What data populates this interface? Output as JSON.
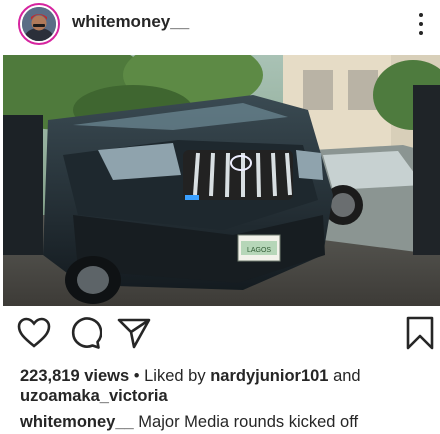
{
  "header": {
    "username": "whitemoney__",
    "avatar_icon": "profile-avatar",
    "more_icon": "more-options-icon"
  },
  "post": {
    "image_icon": "suv-photo",
    "plate_text": "LAGOS"
  },
  "actions": {
    "like_icon": "heart-icon",
    "comment_icon": "comment-icon",
    "share_icon": "send-icon",
    "save_icon": "bookmark-icon"
  },
  "stats": {
    "views": "223,819 views",
    "separator": " • Liked by ",
    "liked_by_user": "nardyjunior101",
    "and": " and",
    "other_user": "uzoamaka_victoria"
  },
  "caption": {
    "author": "whitemoney__",
    "text": " Major Media rounds kicked off"
  },
  "colors": {
    "text": "#262626",
    "story_ring": "#d6249f"
  }
}
